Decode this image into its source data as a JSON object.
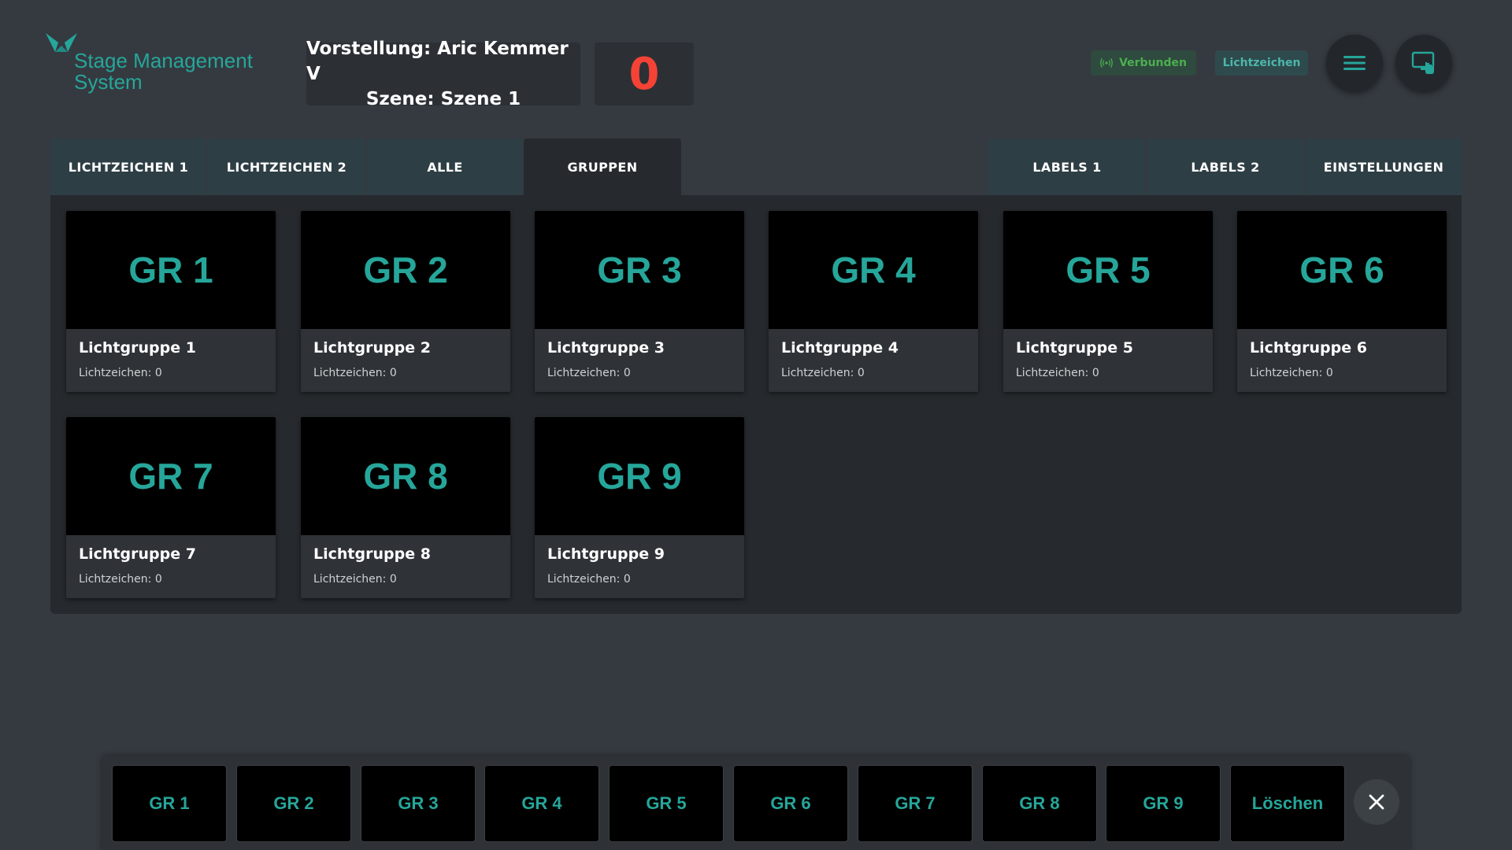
{
  "app": {
    "logo_text": "Stage Management\nSystem",
    "accent_color": "#26a69a"
  },
  "header": {
    "show_label": "Vorstellung:",
    "show_value": "Aric Kemmer V",
    "scene_label": "Szene:",
    "scene_value": "Szene 1",
    "counter": "0",
    "status_connected": "Verbunden",
    "mode_label": "Lichtzeichen",
    "menu_icon": "hamburger-menu-icon",
    "display_icon": "touch-monitor-icon"
  },
  "tabs": [
    {
      "label": "LICHTZEICHEN 1"
    },
    {
      "label": "LICHTZEICHEN 2"
    },
    {
      "label": "ALLE"
    },
    {
      "label": "GRUPPEN",
      "active": true
    },
    {
      "label": "LABELS 1"
    },
    {
      "label": "LABELS 2"
    },
    {
      "label": "EINSTELLUNGEN"
    }
  ],
  "groups": [
    {
      "code": "GR 1",
      "name": "Lichtgruppe 1",
      "count": "Lichtzeichen: 0"
    },
    {
      "code": "GR 2",
      "name": "Lichtgruppe 2",
      "count": "Lichtzeichen: 0"
    },
    {
      "code": "GR 3",
      "name": "Lichtgruppe 3",
      "count": "Lichtzeichen: 0"
    },
    {
      "code": "GR 4",
      "name": "Lichtgruppe 4",
      "count": "Lichtzeichen: 0"
    },
    {
      "code": "GR 5",
      "name": "Lichtgruppe 5",
      "count": "Lichtzeichen: 0"
    },
    {
      "code": "GR 6",
      "name": "Lichtgruppe 6",
      "count": "Lichtzeichen: 0"
    },
    {
      "code": "GR 7",
      "name": "Lichtgruppe 7",
      "count": "Lichtzeichen: 0"
    },
    {
      "code": "GR 8",
      "name": "Lichtgruppe 8",
      "count": "Lichtzeichen: 0"
    },
    {
      "code": "GR 9",
      "name": "Lichtgruppe 9",
      "count": "Lichtzeichen: 0"
    }
  ],
  "quickbar": {
    "buttons": [
      "GR 1",
      "GR 2",
      "GR 3",
      "GR 4",
      "GR 5",
      "GR 6",
      "GR 7",
      "GR 8",
      "GR 9"
    ],
    "delete_label": "Löschen",
    "close_icon": "close-icon"
  }
}
